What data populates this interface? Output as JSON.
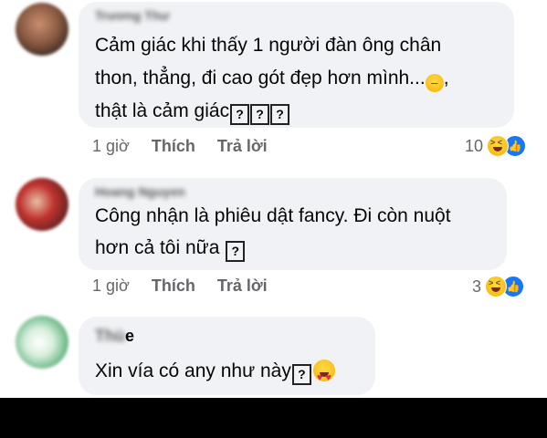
{
  "comments": [
    {
      "author": "Trương Thư",
      "lines": [
        "Cảm giác khi thấy 1 người đàn ông chân",
        "thon, thẳng, đi cao gót đẹp hơn mình...",
        ", ",
        "thật là cảm giác"
      ],
      "qmarks": [
        "?",
        "?",
        "?"
      ],
      "time": "1 giờ",
      "like_label": "Thích",
      "reply_label": "Trả lời",
      "reaction_count": "10"
    },
    {
      "author": "Hoang Nguyen",
      "author_suffix": "n",
      "lines": [
        "Công nhận là phiêu dật fancy. Đi còn nuột",
        "hơn cả tôi nữa "
      ],
      "qmarks": [
        "?"
      ],
      "time": "1 giờ",
      "like_label": "Thích",
      "reply_label": "Trả lời",
      "reaction_count": "3"
    },
    {
      "author_blur": "Thù",
      "author_suffix": "e",
      "lines": [
        "Xin vía có any như này"
      ],
      "qmarks": [
        "?"
      ]
    }
  ],
  "colors": {
    "bubble": "#f0f2f5",
    "meta": "#65676b",
    "like_blue": "#1877f2"
  },
  "icons": [
    "expressionless-emoji-icon",
    "laughing-emoji-icon",
    "like-icon",
    "heart-eyes-emoji-icon"
  ]
}
